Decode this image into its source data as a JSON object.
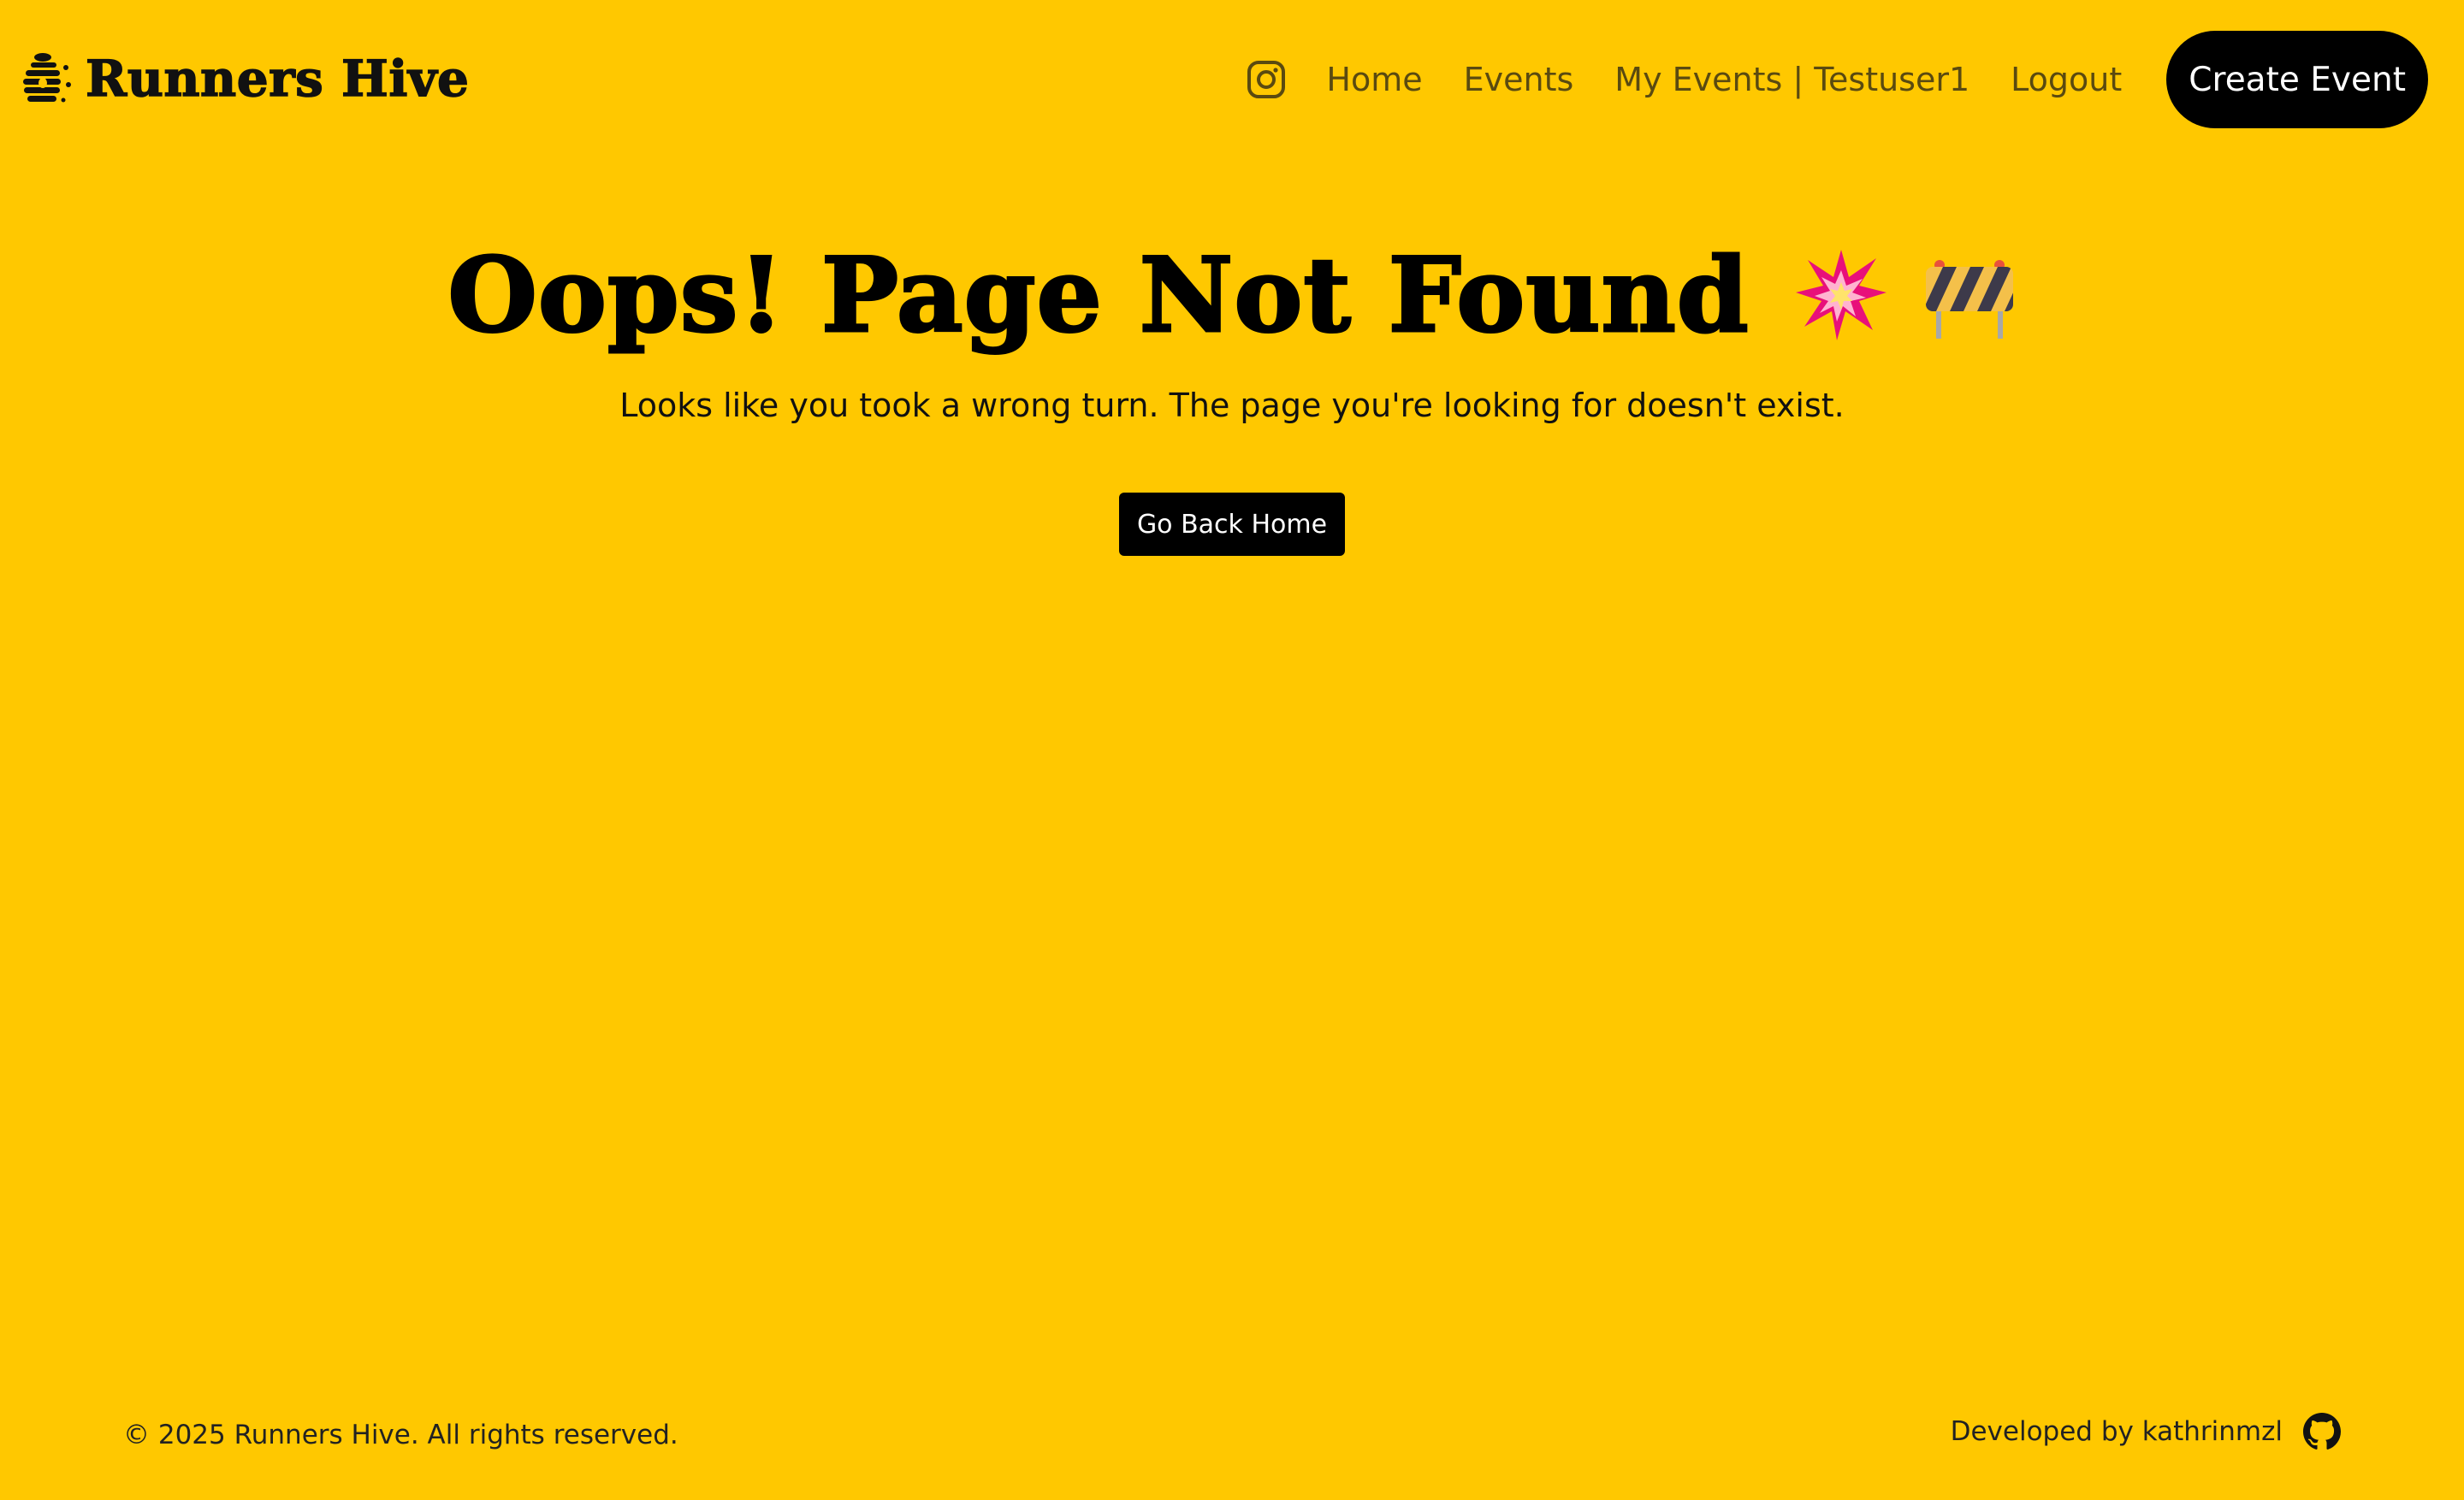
{
  "header": {
    "brand_name": "Runners Hive",
    "brand_icon": "beehive-icon",
    "instagram_icon": "instagram-icon",
    "nav": {
      "home": "Home",
      "events": "Events",
      "my_events": "My Events | Testuser1",
      "logout": "Logout"
    },
    "cta_label": "Create Event"
  },
  "main": {
    "title": "Oops! Page Not Found",
    "emoji_1": "collision-icon",
    "emoji_2": "construction-icon",
    "message": "Looks like you took a wrong turn. The page you're looking for doesn't exist.",
    "home_button": "Go Back Home"
  },
  "footer": {
    "copyright": "© 2025 Runners Hive. All rights reserved.",
    "developed_by": "Developed by kathrinmzl",
    "github_icon": "github-icon"
  },
  "colors": {
    "background": "#FFC800",
    "button_bg": "#000000",
    "button_text": "#FFFFFF",
    "nav_text": "#5A4A10"
  }
}
